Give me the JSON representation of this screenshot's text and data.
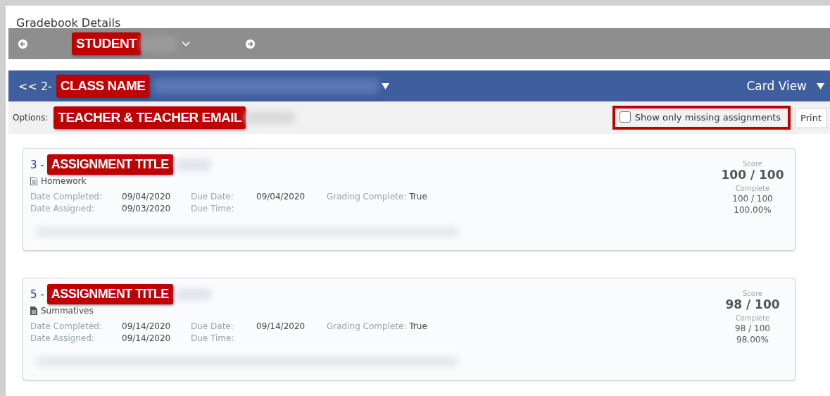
{
  "page": {
    "title": "Gradebook Details"
  },
  "student_bar": {
    "label": "STUDENT"
  },
  "class_bar": {
    "prefix": "<< 2-",
    "label": "CLASS NAME",
    "view": "Card View"
  },
  "options": {
    "label": "Options:",
    "teacher": "TEACHER & TEACHER EMAIL",
    "missing_only": {
      "label": "Show only missing assignments",
      "checked": false
    },
    "print": "Print"
  },
  "assignments": [
    {
      "number": "3 -",
      "title": "ASSIGNMENT TITLE",
      "kind": "outline",
      "category": "Homework",
      "date_completed_label": "Date Completed:",
      "date_completed": "09/04/2020",
      "due_date_label": "Due Date:",
      "due_date": "09/04/2020",
      "grading_label": "Grading Complete:",
      "grading": "True",
      "date_assigned_label": "Date Assigned:",
      "date_assigned": "09/03/2020",
      "due_time_label": "Due Time:",
      "score_label": "Score",
      "score": "100 / 100",
      "complete_label": "Complete",
      "complete": "100 / 100",
      "percent": "100.00%"
    },
    {
      "number": "5 -",
      "title": "ASSIGNMENT TITLE",
      "kind": "filled",
      "category": "Summatives",
      "date_completed_label": "Date Completed:",
      "date_completed": "09/14/2020",
      "due_date_label": "Due Date:",
      "due_date": "09/14/2020",
      "grading_label": "Grading Complete:",
      "grading": "True",
      "date_assigned_label": "Date Assigned:",
      "date_assigned": "09/14/2020",
      "due_time_label": "Due Time:",
      "score_label": "Score",
      "score": "98 / 100",
      "complete_label": "Complete",
      "complete": "98 / 100",
      "percent": "98.00%"
    }
  ]
}
